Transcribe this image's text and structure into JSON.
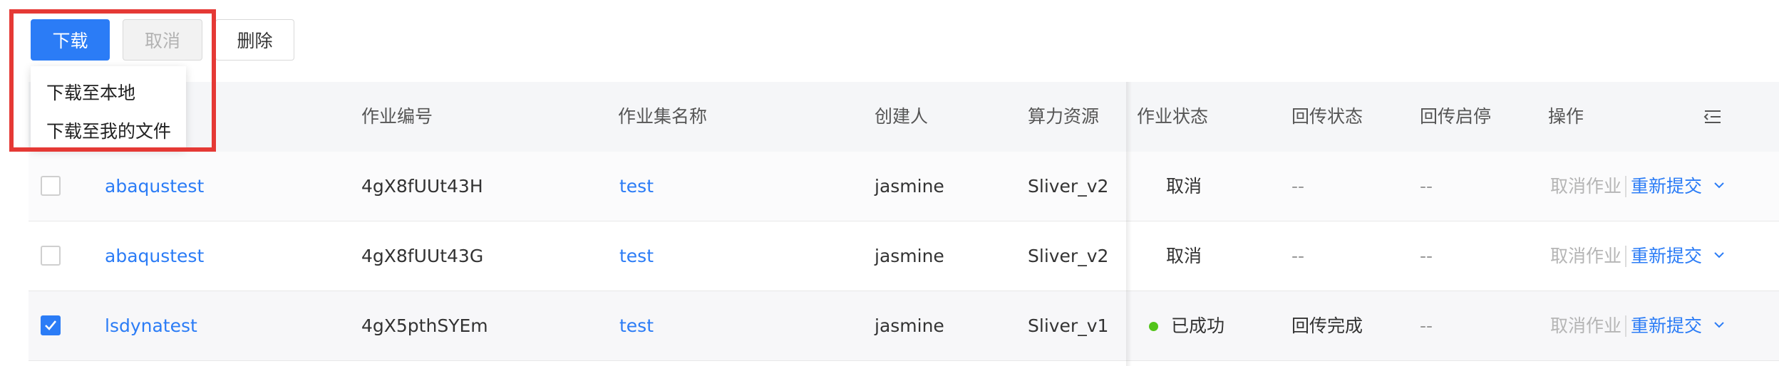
{
  "toolbar": {
    "download_label": "下载",
    "cancel_label": "取消",
    "delete_label": "删除"
  },
  "download_menu": {
    "items": [
      "下载至本地",
      "下载至我的文件"
    ]
  },
  "table": {
    "columns": {
      "job_id": "作业编号",
      "job_set_name": "作业集名称",
      "creator": "创建人",
      "compute": "算力资源",
      "job_status": "作业状态",
      "return_status": "回传状态",
      "return_toggle": "回传启停",
      "actions": "操作"
    },
    "rows": [
      {
        "checked": false,
        "name": "abaqustest",
        "job_id": "4gX8fUUt43H",
        "job_set": "test",
        "creator": "jasmine",
        "compute": "Sliver_v2",
        "job_status": "取消",
        "return_status": "--",
        "return_toggle": "--",
        "action_cancel": "取消作业",
        "action_resubmit": "重新提交"
      },
      {
        "checked": false,
        "name": "abaqustest",
        "job_id": "4gX8fUUt43G",
        "job_set": "test",
        "creator": "jasmine",
        "compute": "Sliver_v2",
        "job_status": "取消",
        "return_status": "--",
        "return_toggle": "--",
        "action_cancel": "取消作业",
        "action_resubmit": "重新提交"
      },
      {
        "checked": true,
        "name": "lsdynatest",
        "job_id": "4gX5pthSYEm",
        "job_set": "test",
        "creator": "jasmine",
        "compute": "Sliver_v1",
        "job_status": "已成功",
        "status_color": "#52c41a",
        "return_status": "回传完成",
        "return_toggle": "--",
        "action_cancel": "取消作业",
        "action_resubmit": "重新提交"
      }
    ]
  },
  "icons": {
    "column_settings": "column-settings-icon",
    "row_expand": "chevron-down-icon",
    "checkbox_check": "check-icon"
  },
  "colors": {
    "primary": "#2b7cf6",
    "highlight": "#e53935",
    "success": "#52c41a"
  }
}
